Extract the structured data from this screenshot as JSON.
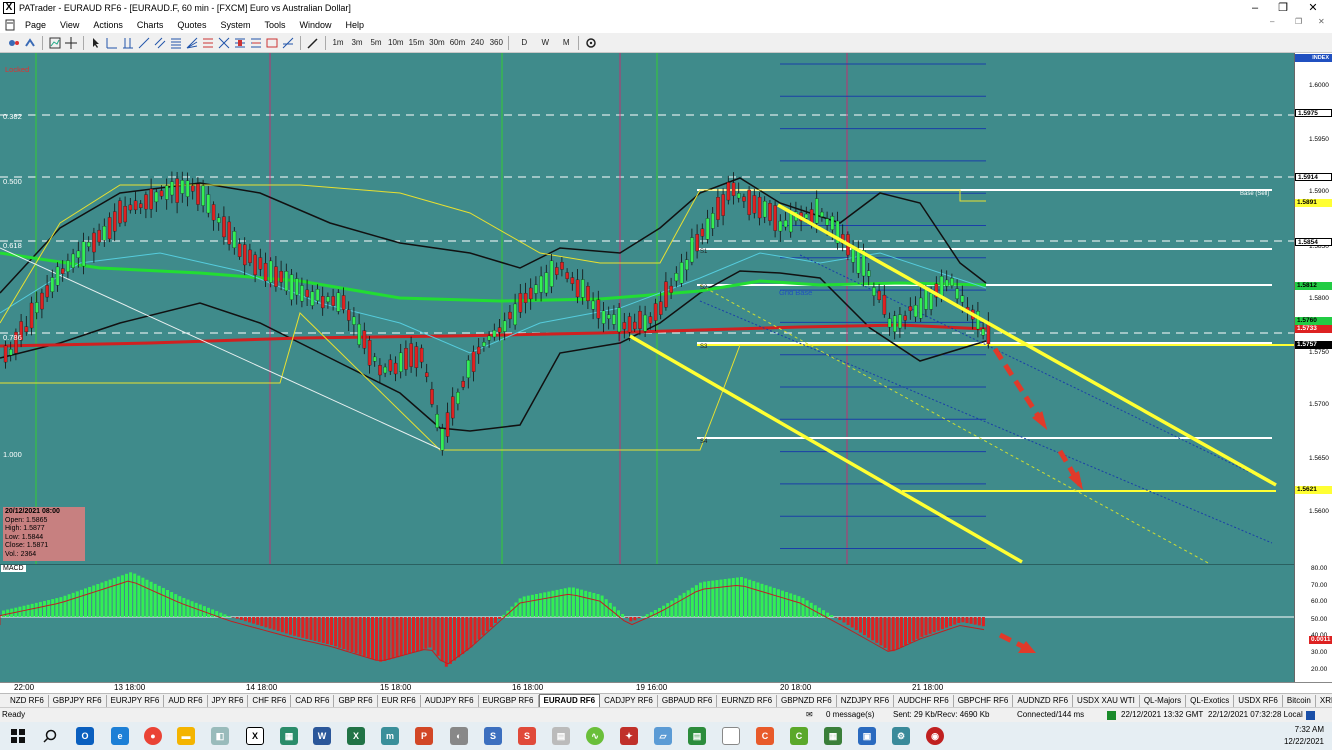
{
  "window": {
    "title": "PATrader - EURAUD RF6 - [EURAUD.F, 60 min - [FXCM] Euro vs Australian Dollar]",
    "controls": {
      "minimize": "–",
      "restore": "❐",
      "close": "✕"
    }
  },
  "menu": {
    "items": [
      "Page",
      "View",
      "Actions",
      "Charts",
      "Quotes",
      "System",
      "Tools",
      "Window",
      "Help"
    ]
  },
  "toolbar": {
    "timeframes": [
      "1m",
      "3m",
      "5m",
      "10m",
      "15m",
      "30m",
      "60m",
      "240",
      "360"
    ],
    "periods": [
      "D",
      "W",
      "M"
    ]
  },
  "chart": {
    "locked_label": "Locked",
    "fib_labels": [
      "0.382",
      "0.500",
      "0.618",
      "0.786",
      "1.000"
    ],
    "grid_base_label": "Grid Base",
    "base_sell_label": "Base (Sell)",
    "level_tags": [
      "S1",
      "S2",
      "S3",
      "S4"
    ],
    "info": {
      "datetime": "20/12/2021 08:00",
      "open": "Open: 1.5865",
      "high": "High: 1.5877",
      "low": "Low: 1.5844",
      "close": "Close: 1.5871",
      "vol": "Vol.: 2364"
    },
    "colors": {
      "background": "#3f8b8b",
      "up": "#33ee55",
      "down": "#dd2222",
      "trend": "#ffff33"
    }
  },
  "price_axis": {
    "index_label": "INDEX",
    "ticks": [
      "1.6000",
      "1.5950",
      "1.5900",
      "1.5850",
      "1.5800",
      "1.5750",
      "1.5700",
      "1.5650",
      "1.5600"
    ],
    "boxes": [
      {
        "v": "1.5975",
        "bg": "#ffffff",
        "fg": "#000000"
      },
      {
        "v": "1.5914",
        "bg": "#ffffff",
        "fg": "#000000"
      },
      {
        "v": "1.5891",
        "bg": "#ffff33",
        "fg": "#000000"
      },
      {
        "v": "1.5854",
        "bg": "#ffffff",
        "fg": "#000000"
      },
      {
        "v": "1.5812",
        "bg": "#22cc44",
        "fg": "#000000"
      },
      {
        "v": "1.5760",
        "bg": "#22cc44",
        "fg": "#000000"
      },
      {
        "v": "1.5733",
        "bg": "#dd2222",
        "fg": "#ffffff"
      },
      {
        "v": "1.5757",
        "bg": "#000000",
        "fg": "#ffffff"
      },
      {
        "v": "1.5621",
        "bg": "#ffff33",
        "fg": "#000000"
      }
    ]
  },
  "macd": {
    "label": "MACD",
    "ticks": [
      "80.00",
      "70.00",
      "60.00",
      "50.00",
      "40.00",
      "30.00",
      "20.00"
    ],
    "value_box": "0.0011"
  },
  "time_axis": {
    "labels": [
      "22:00",
      "13 18:00",
      "14 18:00",
      "15 18:00",
      "16 18:00",
      "19 16:00",
      "20 18:00",
      "21 18:00"
    ]
  },
  "symbol_tabs": {
    "items": [
      "NZD RF6",
      "GBPJPY RF6",
      "EURJPY RF6",
      "AUD RF6",
      "JPY RF6",
      "CHF RF6",
      "CAD RF6",
      "GBP RF6",
      "EUR RF6",
      "AUDJPY RF6",
      "EURGBP RF6",
      "EURAUD RF6",
      "CADJPY RF6",
      "GBPAUD RF6",
      "EURNZD RF6",
      "GBPNZD RF6",
      "NZDJPY RF6",
      "AUDCHF RF6",
      "GBPCHF RF6",
      "AUDNZD RF6",
      "USDX XAU WTI",
      "QL-Majors",
      "QL-Exotics",
      "USDX RF6",
      "Bitcoin",
      "XRPUSDRF6"
    ],
    "active": "EURAUD RF6"
  },
  "status": {
    "ready": "Ready",
    "messages": "0 message(s)",
    "traffic": "Sent: 29 Kb/Recv: 4690 Kb",
    "connection": "Connected/144 ms",
    "gmt": "22/12/2021 13:32 GMT",
    "local": "22/12/2021 07:32:28 Local"
  },
  "taskbar": {
    "time": "7:32 AM",
    "date": "12/22/2021"
  }
}
